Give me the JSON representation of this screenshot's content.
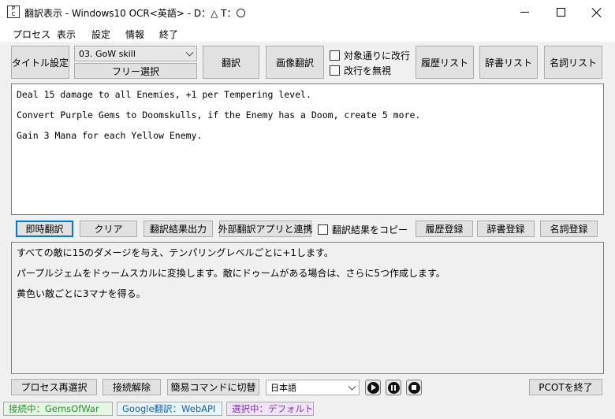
{
  "window": {
    "title": "翻訳表示 - Windows10 OCR<英語> - D：△ T：〇",
    "icon_top": "P",
    "icon_bottom": "C"
  },
  "menu": [
    "プロセス",
    "表示",
    "設定",
    "情報",
    "終了"
  ],
  "toolbar": {
    "title_setting": "タイトル設定",
    "profile_select": "03. GoW skill",
    "free_select": "フリー選択",
    "translate": "翻訳",
    "image_translate": "画像翻訳",
    "wrap_check": "対象通りに改行",
    "ignore_newline_check": "改行を無視",
    "history_list": "履歴リスト",
    "dictionary_list": "辞書リスト",
    "noun_list": "名詞リスト"
  },
  "source_text": [
    "Deal 15 damage to all Enemies, +1 per Tempering level.",
    "Convert Purple Gems to Doomskulls, if the Enemy has a Doom, create 5 more.",
    "Gain 3 Mana for each Yellow Enemy."
  ],
  "action_bar": {
    "instant_translate": "即時翻訳",
    "clear": "クリア",
    "output_result": "翻訳結果出力",
    "external_app": "外部翻訳アプリと連携",
    "copy_result_check": "翻訳結果をコピー",
    "history_register": "履歴登録",
    "dictionary_register": "辞書登録",
    "noun_register": "名詞登録"
  },
  "translated_text": [
    "すべての敵に15のダメージを与え、テンパリングレベルごとに+1します。",
    "パープルジェムをドゥームスカルに変換します。敵にドゥームがある場合は、さらに5つ作成します。",
    "黄色い敵ごとに3マナを得る。"
  ],
  "bottom_bar": {
    "reselect_process": "プロセス再選択",
    "disconnect": "接続解除",
    "simple_command": "簡易コマンドに切替",
    "language_select": "日本語",
    "exit_pcot": "PCOTを終了"
  },
  "status": {
    "connection": "接続中：GemsOfWar",
    "engine": "Google翻訳：WebAPI",
    "selection": "選択中：デフォルト"
  },
  "colors": {
    "status_connection_bg": "#e3f7e3",
    "status_connection_fg": "#2e8b2e",
    "status_engine_bg": "#e6f4fb",
    "status_engine_fg": "#1d5fa0",
    "status_selection_bg": "#efe3f7",
    "status_selection_fg": "#7a3aa6",
    "focus_border": "#0078d7"
  }
}
